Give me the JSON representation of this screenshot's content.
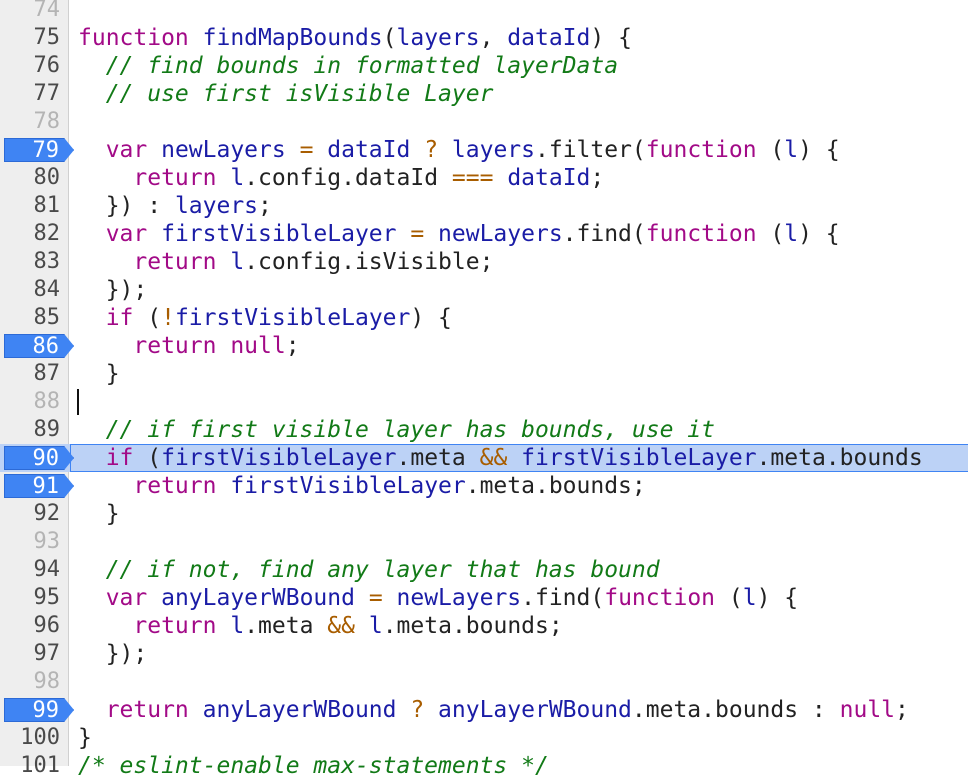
{
  "editor": {
    "lines": [
      {
        "num": "74",
        "dim": true,
        "bp": false,
        "current": false,
        "tokens": []
      },
      {
        "num": "75",
        "dim": false,
        "bp": false,
        "current": false,
        "tokens": [
          {
            "t": "function ",
            "c": "kw"
          },
          {
            "t": "findMapBounds",
            "c": "id"
          },
          {
            "t": "(",
            "c": "pl"
          },
          {
            "t": "layers",
            "c": "id"
          },
          {
            "t": ", ",
            "c": "pl"
          },
          {
            "t": "dataId",
            "c": "id"
          },
          {
            "t": ") {",
            "c": "pl"
          }
        ]
      },
      {
        "num": "76",
        "dim": false,
        "bp": false,
        "current": false,
        "tokens": [
          {
            "t": "  // find bounds in formatted layerData",
            "c": "cm"
          }
        ]
      },
      {
        "num": "77",
        "dim": false,
        "bp": false,
        "current": false,
        "tokens": [
          {
            "t": "  // use first isVisible Layer",
            "c": "cm"
          }
        ]
      },
      {
        "num": "78",
        "dim": true,
        "bp": false,
        "current": false,
        "tokens": []
      },
      {
        "num": "79",
        "dim": false,
        "bp": true,
        "current": false,
        "tokens": [
          {
            "t": "  var ",
            "c": "kw"
          },
          {
            "t": "newLayers",
            "c": "id"
          },
          {
            "t": " = ",
            "c": "op"
          },
          {
            "t": "dataId",
            "c": "id"
          },
          {
            "t": " ? ",
            "c": "op"
          },
          {
            "t": "layers",
            "c": "id"
          },
          {
            "t": ".filter(",
            "c": "pl"
          },
          {
            "t": "function",
            "c": "kw"
          },
          {
            "t": " (",
            "c": "pl"
          },
          {
            "t": "l",
            "c": "id"
          },
          {
            "t": ") {",
            "c": "pl"
          }
        ]
      },
      {
        "num": "80",
        "dim": false,
        "bp": false,
        "current": false,
        "tokens": [
          {
            "t": "    return ",
            "c": "kw"
          },
          {
            "t": "l",
            "c": "id"
          },
          {
            "t": ".config.dataId ",
            "c": "pl"
          },
          {
            "t": "===",
            "c": "op"
          },
          {
            "t": " ",
            "c": "pl"
          },
          {
            "t": "dataId",
            "c": "id"
          },
          {
            "t": ";",
            "c": "pl"
          }
        ]
      },
      {
        "num": "81",
        "dim": false,
        "bp": false,
        "current": false,
        "tokens": [
          {
            "t": "  }) : ",
            "c": "pl"
          },
          {
            "t": "layers",
            "c": "id"
          },
          {
            "t": ";",
            "c": "pl"
          }
        ]
      },
      {
        "num": "82",
        "dim": false,
        "bp": false,
        "current": false,
        "tokens": [
          {
            "t": "  var ",
            "c": "kw"
          },
          {
            "t": "firstVisibleLayer",
            "c": "id"
          },
          {
            "t": " = ",
            "c": "op"
          },
          {
            "t": "newLayers",
            "c": "id"
          },
          {
            "t": ".find(",
            "c": "pl"
          },
          {
            "t": "function",
            "c": "kw"
          },
          {
            "t": " (",
            "c": "pl"
          },
          {
            "t": "l",
            "c": "id"
          },
          {
            "t": ") {",
            "c": "pl"
          }
        ]
      },
      {
        "num": "83",
        "dim": false,
        "bp": false,
        "current": false,
        "tokens": [
          {
            "t": "    return ",
            "c": "kw"
          },
          {
            "t": "l",
            "c": "id"
          },
          {
            "t": ".config.isVisible;",
            "c": "pl"
          }
        ]
      },
      {
        "num": "84",
        "dim": false,
        "bp": false,
        "current": false,
        "tokens": [
          {
            "t": "  });",
            "c": "pl"
          }
        ]
      },
      {
        "num": "85",
        "dim": false,
        "bp": false,
        "current": false,
        "tokens": [
          {
            "t": "  if",
            "c": "kw"
          },
          {
            "t": " (",
            "c": "pl"
          },
          {
            "t": "!",
            "c": "op"
          },
          {
            "t": "firstVisibleLayer",
            "c": "id"
          },
          {
            "t": ") {",
            "c": "pl"
          }
        ]
      },
      {
        "num": "86",
        "dim": false,
        "bp": true,
        "current": false,
        "tokens": [
          {
            "t": "    return null",
            "c": "kw"
          },
          {
            "t": ";",
            "c": "pl"
          }
        ]
      },
      {
        "num": "87",
        "dim": false,
        "bp": false,
        "current": false,
        "tokens": [
          {
            "t": "  }",
            "c": "pl"
          }
        ]
      },
      {
        "num": "88",
        "dim": true,
        "bp": false,
        "current": false,
        "caret": true,
        "tokens": []
      },
      {
        "num": "89",
        "dim": false,
        "bp": false,
        "current": false,
        "tokens": [
          {
            "t": "  // if first visible layer has bounds, use it",
            "c": "cm"
          }
        ]
      },
      {
        "num": "90",
        "dim": false,
        "bp": true,
        "current": true,
        "tokens": [
          {
            "t": "  if",
            "c": "kw"
          },
          {
            "t": " (",
            "c": "pl"
          },
          {
            "t": "firstVisibleLayer",
            "c": "id"
          },
          {
            "t": ".meta ",
            "c": "pl"
          },
          {
            "t": "&&",
            "c": "op"
          },
          {
            "t": " ",
            "c": "pl"
          },
          {
            "t": "firstVisibleLayer",
            "c": "id"
          },
          {
            "t": ".meta.bounds",
            "c": "pl"
          }
        ]
      },
      {
        "num": "91",
        "dim": false,
        "bp": true,
        "current": false,
        "tokens": [
          {
            "t": "    return ",
            "c": "kw"
          },
          {
            "t": "firstVisibleLayer",
            "c": "id"
          },
          {
            "t": ".meta.bounds;",
            "c": "pl"
          }
        ]
      },
      {
        "num": "92",
        "dim": false,
        "bp": false,
        "current": false,
        "tokens": [
          {
            "t": "  }",
            "c": "pl"
          }
        ]
      },
      {
        "num": "93",
        "dim": true,
        "bp": false,
        "current": false,
        "tokens": []
      },
      {
        "num": "94",
        "dim": false,
        "bp": false,
        "current": false,
        "tokens": [
          {
            "t": "  // if not, find any layer that has bound",
            "c": "cm"
          }
        ]
      },
      {
        "num": "95",
        "dim": false,
        "bp": false,
        "current": false,
        "tokens": [
          {
            "t": "  var ",
            "c": "kw"
          },
          {
            "t": "anyLayerWBound",
            "c": "id"
          },
          {
            "t": " = ",
            "c": "op"
          },
          {
            "t": "newLayers",
            "c": "id"
          },
          {
            "t": ".find(",
            "c": "pl"
          },
          {
            "t": "function",
            "c": "kw"
          },
          {
            "t": " (",
            "c": "pl"
          },
          {
            "t": "l",
            "c": "id"
          },
          {
            "t": ") {",
            "c": "pl"
          }
        ]
      },
      {
        "num": "96",
        "dim": false,
        "bp": false,
        "current": false,
        "tokens": [
          {
            "t": "    return ",
            "c": "kw"
          },
          {
            "t": "l",
            "c": "id"
          },
          {
            "t": ".meta ",
            "c": "pl"
          },
          {
            "t": "&&",
            "c": "op"
          },
          {
            "t": " ",
            "c": "pl"
          },
          {
            "t": "l",
            "c": "id"
          },
          {
            "t": ".meta.bounds;",
            "c": "pl"
          }
        ]
      },
      {
        "num": "97",
        "dim": false,
        "bp": false,
        "current": false,
        "tokens": [
          {
            "t": "  });",
            "c": "pl"
          }
        ]
      },
      {
        "num": "98",
        "dim": true,
        "bp": false,
        "current": false,
        "tokens": []
      },
      {
        "num": "99",
        "dim": false,
        "bp": true,
        "current": false,
        "tokens": [
          {
            "t": "  return ",
            "c": "kw"
          },
          {
            "t": "anyLayerWBound",
            "c": "id"
          },
          {
            "t": " ? ",
            "c": "op"
          },
          {
            "t": "anyLayerWBound",
            "c": "id"
          },
          {
            "t": ".meta.bounds : ",
            "c": "pl"
          },
          {
            "t": "null",
            "c": "kw"
          },
          {
            "t": ";",
            "c": "pl"
          }
        ]
      },
      {
        "num": "100",
        "dim": false,
        "bp": false,
        "current": false,
        "tokens": [
          {
            "t": "}",
            "c": "pl"
          }
        ]
      },
      {
        "num": "101",
        "dim": false,
        "bp": false,
        "current": false,
        "tokens": [
          {
            "t": "/* eslint-enable max-statements */",
            "c": "cm"
          }
        ]
      }
    ]
  },
  "colors": {
    "keyword": "#a20a87",
    "identifier": "#1a1ca6",
    "operator": "#a85d00",
    "comment": "#127a17",
    "breakpoint": "#3f84f3",
    "current_line": "#bcd2f6"
  }
}
